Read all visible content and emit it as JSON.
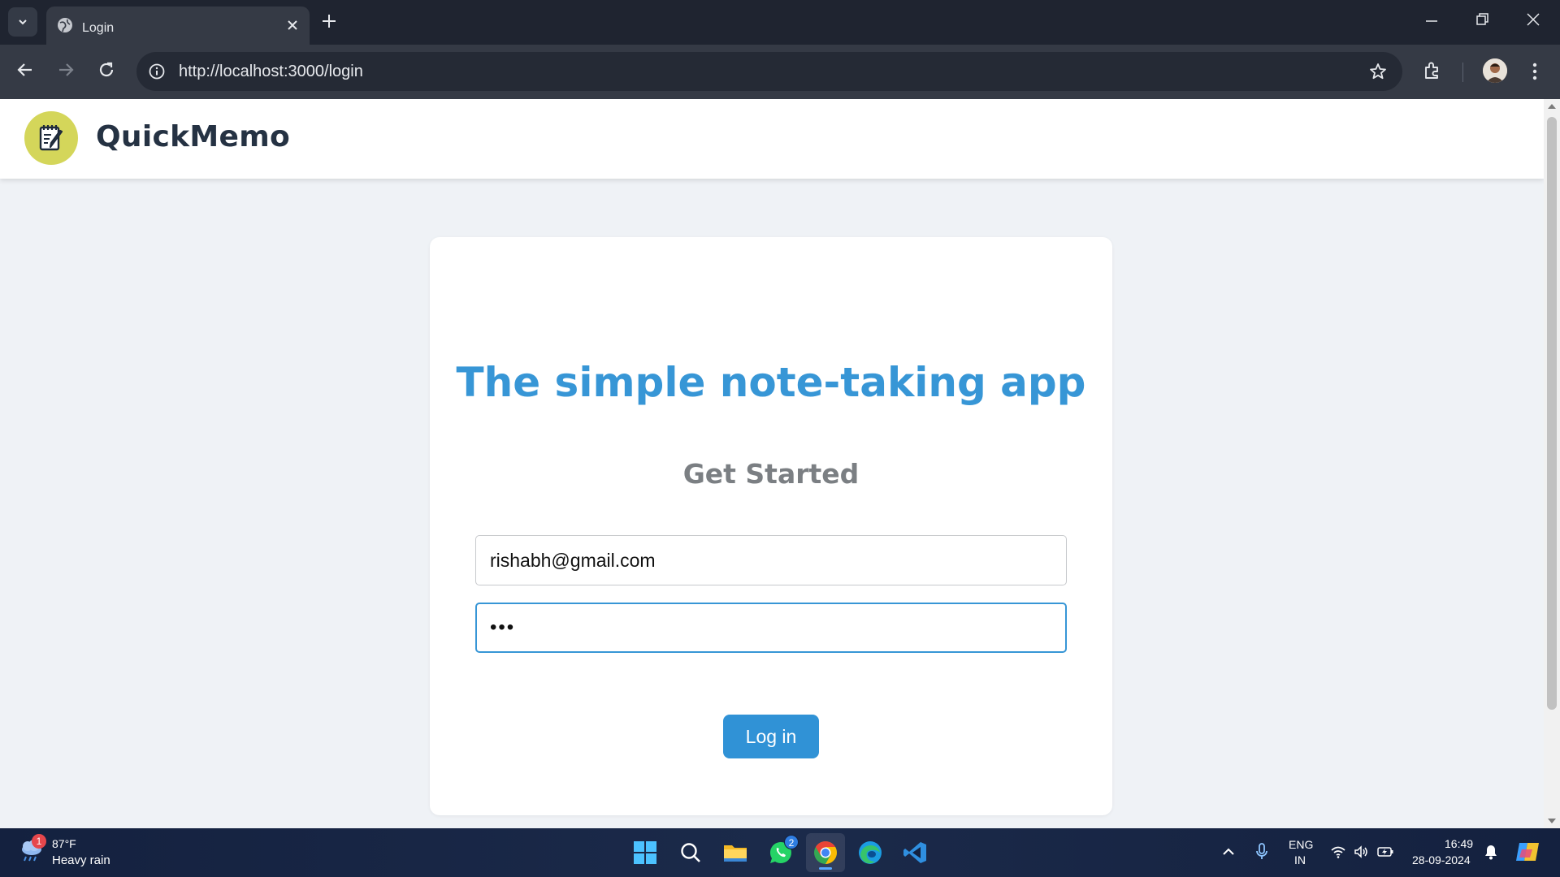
{
  "browser": {
    "tab_title": "Login",
    "url": "http://localhost:3000/login"
  },
  "app": {
    "brand": "QuickMemo",
    "headline": "The simple note-taking app",
    "subhead": "Get Started",
    "email_value": "rishabh@gmail.com",
    "password_value": "•••",
    "login_label": "Log in",
    "accent_color": "#3796d6"
  },
  "taskbar": {
    "weather_badge": "1",
    "temperature": "87°F",
    "condition": "Heavy rain",
    "whatsapp_badge": "2",
    "lang_top": "ENG",
    "lang_bottom": "IN",
    "time": "16:49",
    "date": "28-09-2024"
  }
}
